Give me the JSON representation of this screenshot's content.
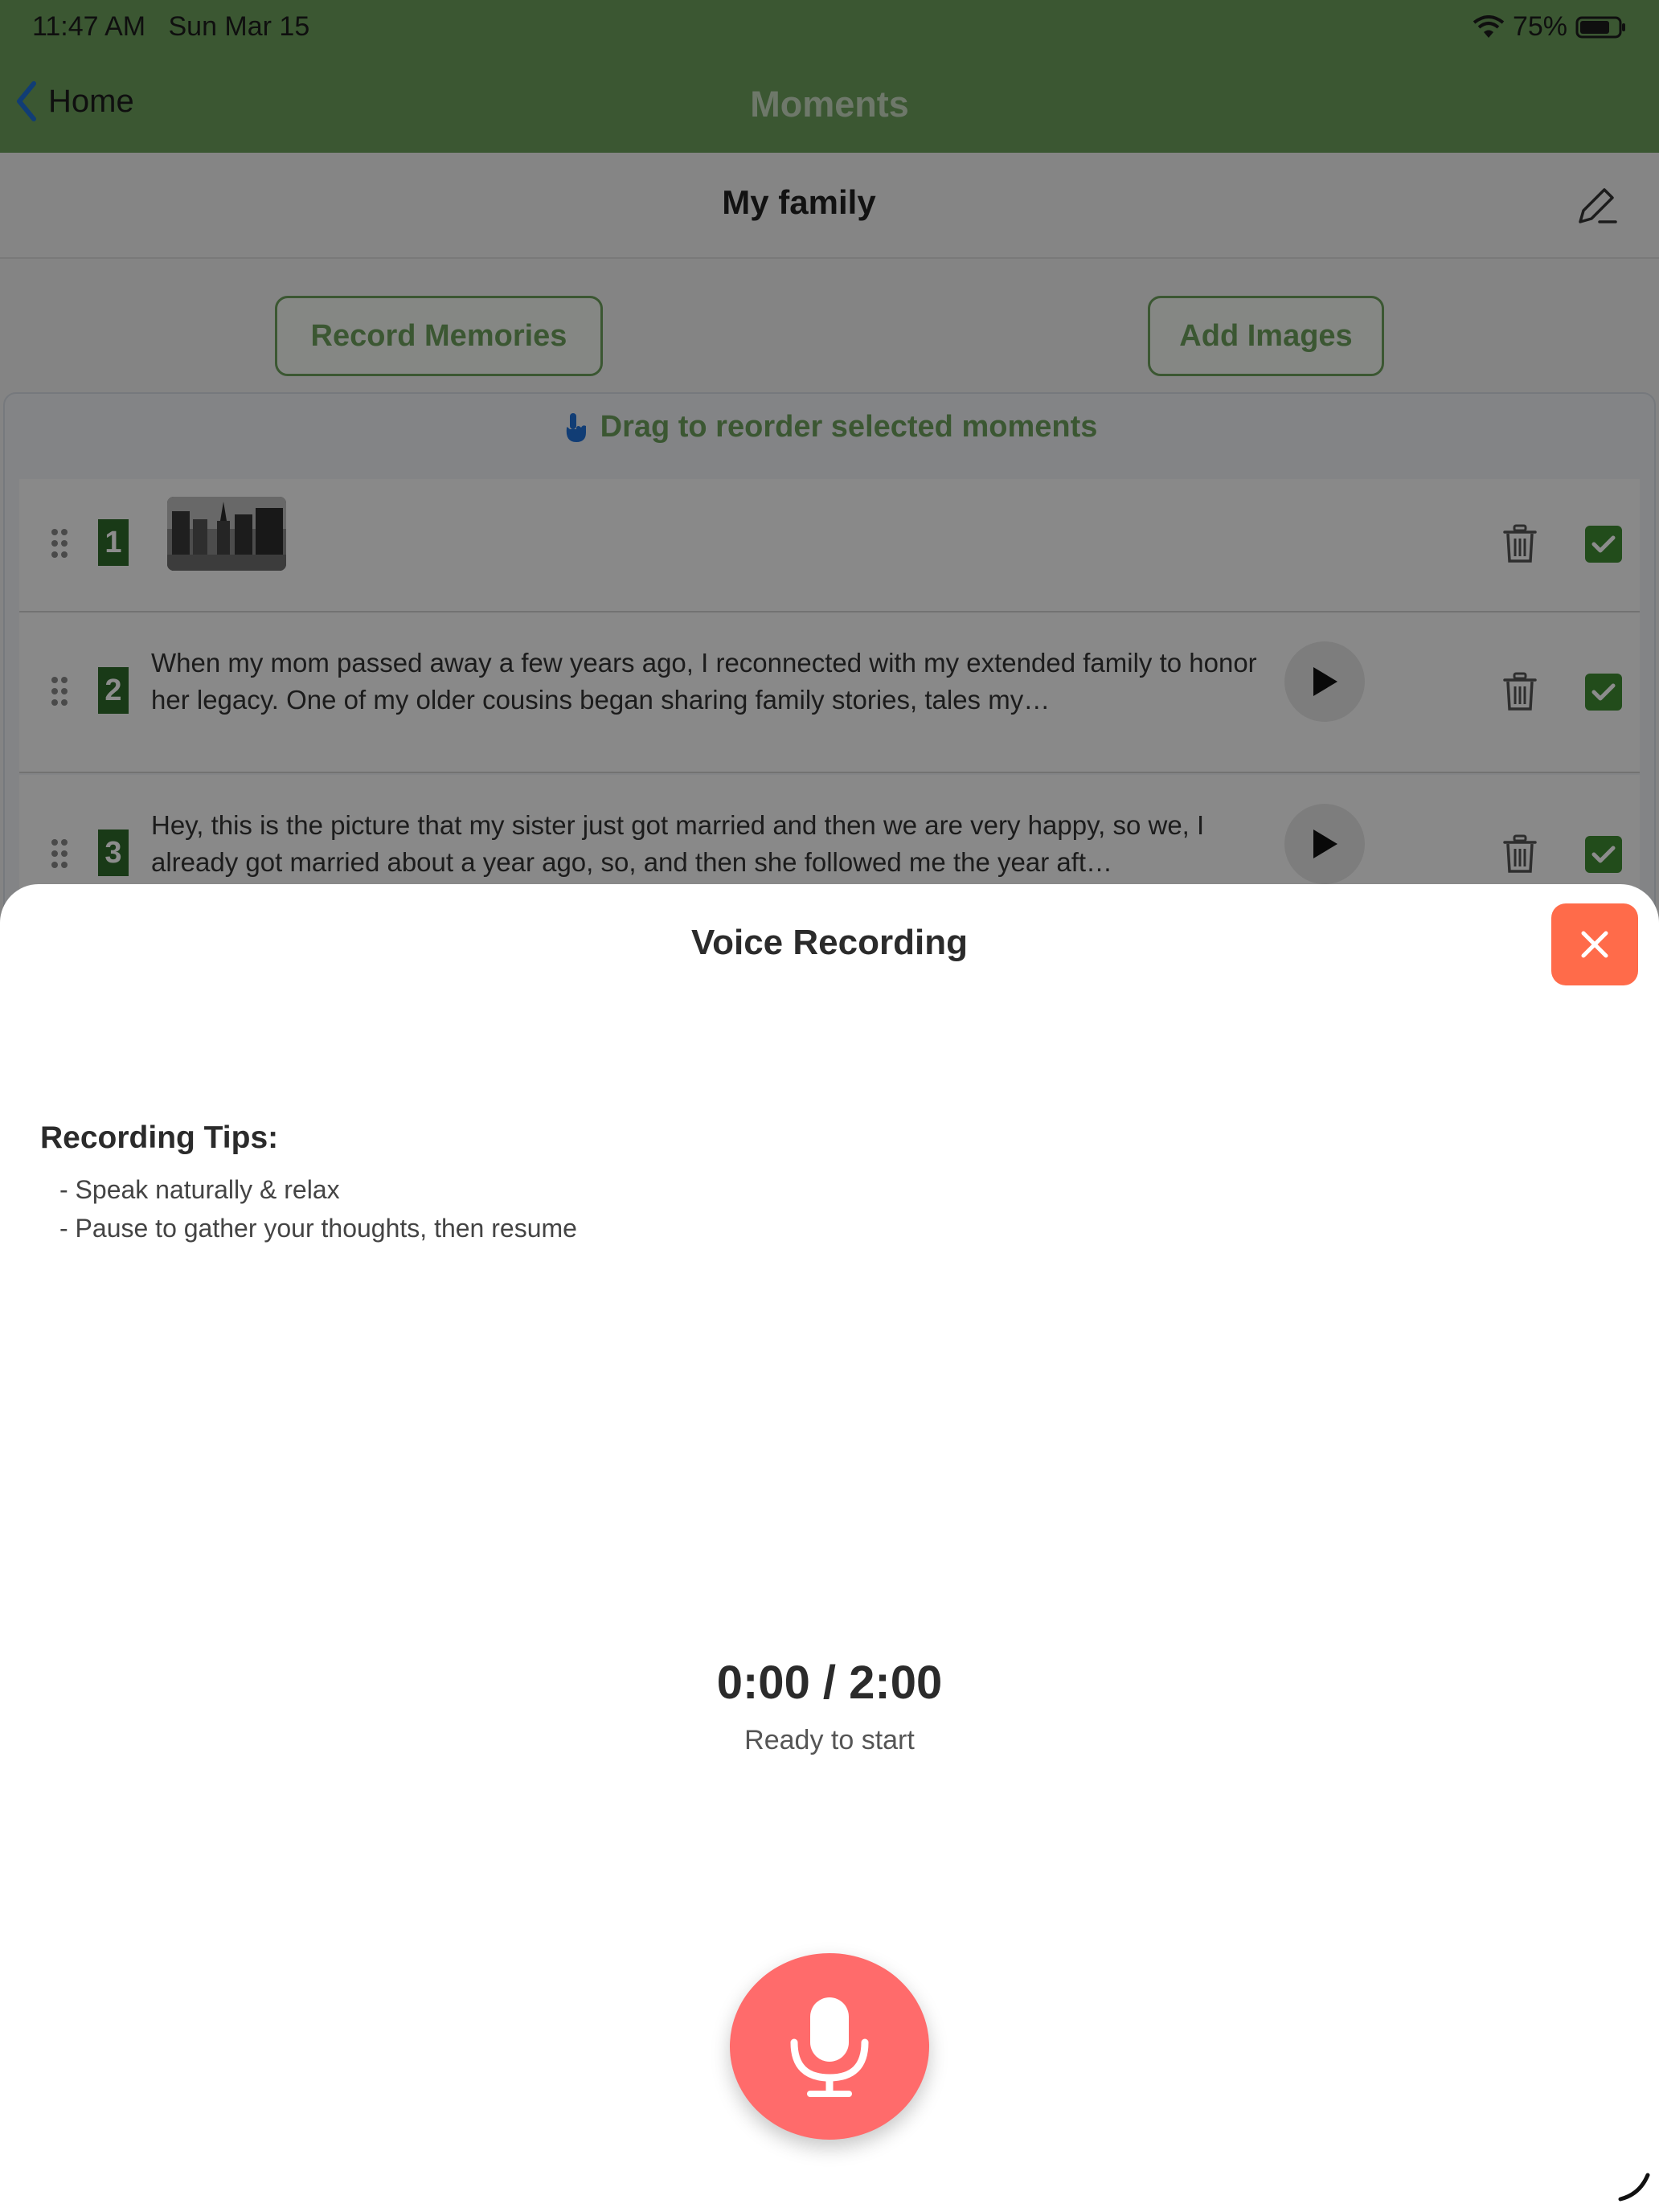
{
  "status_bar": {
    "time": "11:47 AM",
    "date": "Sun Mar 15",
    "battery": "75%"
  },
  "nav": {
    "back_label": "Home",
    "title": "Moments"
  },
  "album": {
    "title": "My family"
  },
  "actions": {
    "record_label": "Record Memories",
    "add_images_label": "Add Images"
  },
  "drag_hint": "Drag to reorder selected moments",
  "moments": [
    {
      "number": "1",
      "type": "image",
      "text": ""
    },
    {
      "number": "2",
      "type": "audio",
      "text": "When my mom passed away a few years ago, I reconnected with my extended family to honor her legacy. One of my older cousins began sharing family stories, tales my…"
    },
    {
      "number": "3",
      "type": "audio",
      "text": "Hey, this is the picture that my sister just got married and then we are very happy, so we, I already got married about a year ago, so, and then she followed me the year aft…"
    }
  ],
  "modal": {
    "title": "Voice Recording",
    "tips_heading": "Recording Tips:",
    "tips": [
      "- Speak naturally & relax",
      "- Pause to gather your thoughts, then resume"
    ],
    "timer": "0:00 / 2:00",
    "status": "Ready to start"
  },
  "colors": {
    "primary_green": "#6c9e5c",
    "badge_green": "#2e6b2a",
    "close_orange": "#ff6b4a",
    "mic_red": "#ff6b6b"
  },
  "icons": [
    "wifi-icon",
    "battery-icon",
    "chevron-left-icon",
    "pencil-icon",
    "hand-pointer-icon",
    "drag-handle-icon",
    "play-icon",
    "trash-icon",
    "checkbox-checked-icon",
    "close-icon",
    "microphone-icon"
  ]
}
